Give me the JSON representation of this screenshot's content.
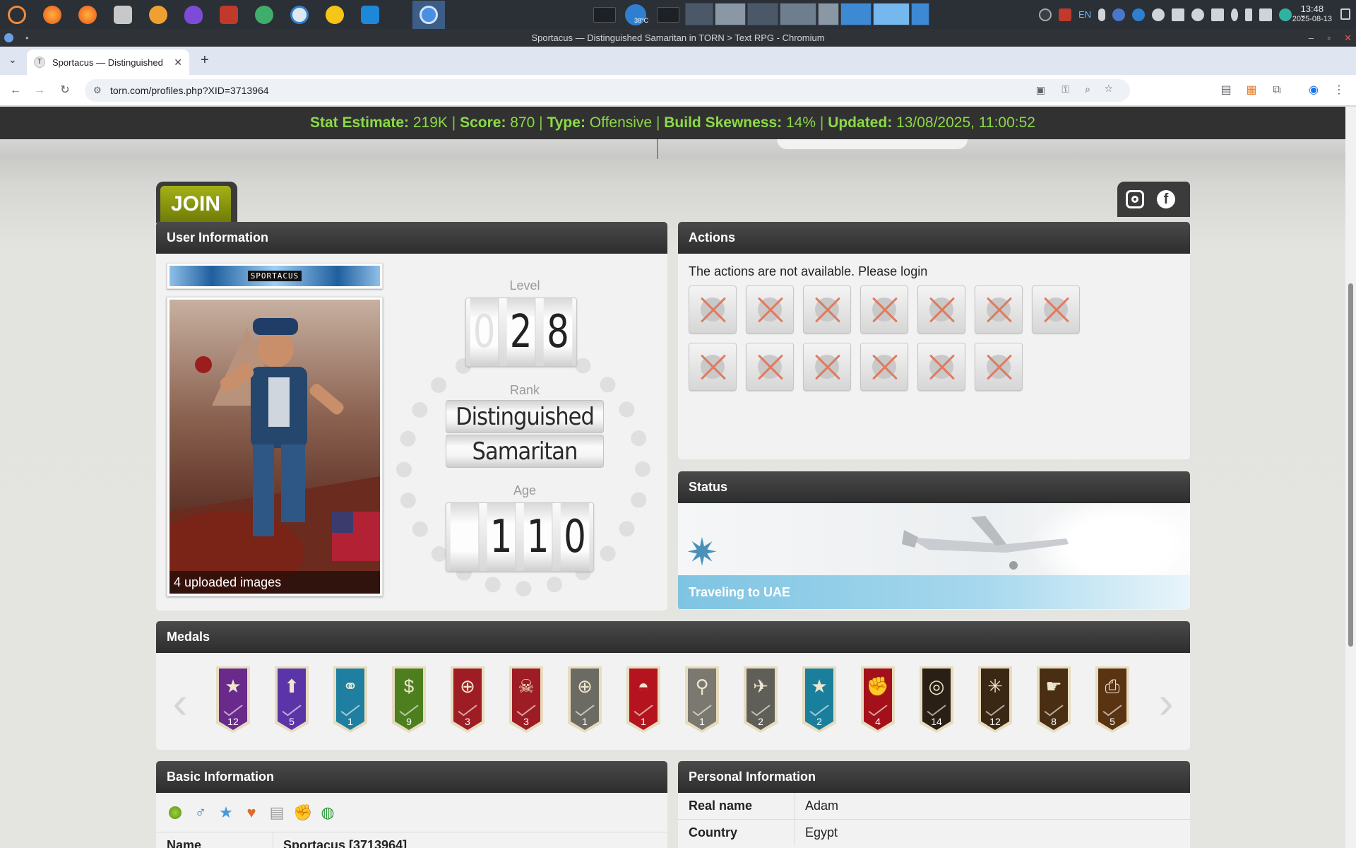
{
  "os": {
    "taskbar_apps": [
      "system-menu",
      "firefox",
      "firefox-2",
      "file-manager",
      "night-light",
      "tor-browser",
      "app-red",
      "app-green",
      "app-globe",
      "emoji",
      "vscode",
      "chromium"
    ],
    "weather_temp": "38°C",
    "keyboard_layout": "EN",
    "clock_time": "13:48",
    "clock_date": "2025-08-13"
  },
  "browser": {
    "window_title": "Sportacus — Distinguished Samaritan in TORN > Text RPG - Chromium",
    "tab_title": "Sportacus — Distinguished",
    "tab_favicon": "T",
    "url": "torn.com/profiles.php?XID=3713964"
  },
  "statbar": {
    "estimate_label": "Stat Estimate:",
    "estimate_value": "219K",
    "score_label": "Score:",
    "score_value": "870",
    "type_label": "Type:",
    "type_value": "Offensive",
    "skew_label": "Build Skewness:",
    "skew_value": "14%",
    "updated_label": "Updated:",
    "updated_value": "13/08/2025, 11:00:52",
    "separator": "|"
  },
  "join_button": "JOIN",
  "user_info": {
    "title": "User Information",
    "nameplate_text": "SPORTACUS",
    "avatar_caption": "4 uploaded images",
    "level_label": "Level",
    "level_digits": [
      "0",
      "2",
      "8"
    ],
    "rank_label": "Rank",
    "rank_line1": "Distinguished",
    "rank_line2": "Samaritan",
    "age_label": "Age",
    "age_digits": [
      "",
      "1",
      "1",
      "0"
    ]
  },
  "actions": {
    "title": "Actions",
    "message": "The actions are not available. Please login",
    "buttons": [
      "attack",
      "message",
      "send-money",
      "bounty",
      "trade",
      "revive",
      "bust",
      "report",
      "add-friend",
      "add-enemy",
      "view-bazaar",
      "view-display",
      "place-bounty"
    ]
  },
  "status": {
    "title": "Status",
    "text": "Traveling to UAE",
    "accent": "#7ec4e2"
  },
  "medals": {
    "title": "Medals",
    "items": [
      {
        "name": "level-medal",
        "color": "#6a2a8c",
        "glyph": "★",
        "count": "12"
      },
      {
        "name": "rank-medal",
        "color": "#5b35a8",
        "glyph": "⬆",
        "count": "5"
      },
      {
        "name": "marriage-medal",
        "color": "#1e7fa0",
        "glyph": "⚭",
        "count": "1"
      },
      {
        "name": "money-medal",
        "color": "#4d7f1f",
        "glyph": "$",
        "count": "9"
      },
      {
        "name": "target-medal",
        "color": "#9e1c24",
        "glyph": "⊕",
        "count": "3"
      },
      {
        "name": "skull-medal",
        "color": "#9e1c24",
        "glyph": "☠",
        "count": "3"
      },
      {
        "name": "medic-medal",
        "color": "#6b6b63",
        "glyph": "⊕",
        "count": "1"
      },
      {
        "name": "hat-medal",
        "color": "#b5141f",
        "glyph": "◓",
        "count": "1"
      },
      {
        "name": "location-medal",
        "color": "#7b7870",
        "glyph": "⚲",
        "count": "1"
      },
      {
        "name": "plane-medal",
        "color": "#5f5f57",
        "glyph": "✈",
        "count": "2"
      },
      {
        "name": "star-medal",
        "color": "#1a7f9c",
        "glyph": "★",
        "count": "2"
      },
      {
        "name": "fist-medal",
        "color": "#a3101a",
        "glyph": "✊",
        "count": "4"
      },
      {
        "name": "fingerprint-medal",
        "color": "#2a1f15",
        "glyph": "◎",
        "count": "14"
      },
      {
        "name": "crack-medal",
        "color": "#3a2815",
        "glyph": "✳",
        "count": "12"
      },
      {
        "name": "hand-medal",
        "color": "#4a2e14",
        "glyph": "☛",
        "count": "8"
      },
      {
        "name": "printer-medal",
        "color": "#5a3312",
        "glyph": "⎙",
        "count": "5"
      }
    ]
  },
  "basic_info": {
    "title": "Basic Information",
    "icons": [
      "online-status-icon",
      "male-icon",
      "donator-star-icon",
      "married-heart-icon",
      "job-icon",
      "faction-icon",
      "travel-globe-icon"
    ],
    "name_label": "Name",
    "name_value": "Sportacus [3713964]"
  },
  "personal_info": {
    "title": "Personal Information",
    "rows": [
      {
        "label": "Real name",
        "value": "Adam"
      },
      {
        "label": "Country",
        "value": "Egypt"
      }
    ]
  }
}
